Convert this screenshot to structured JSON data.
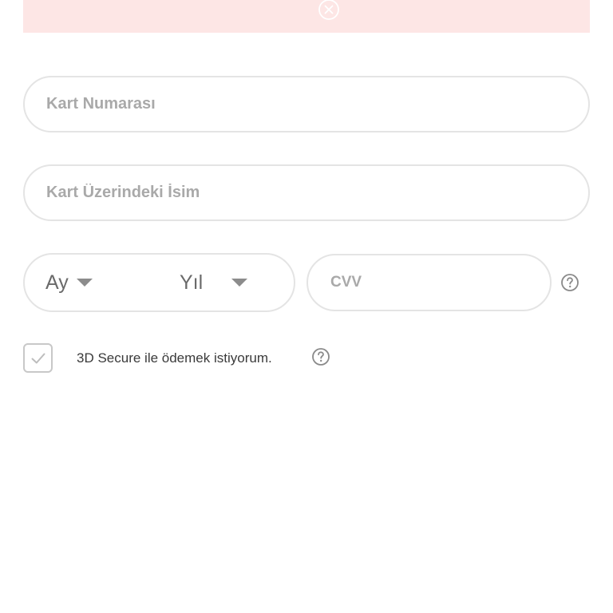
{
  "alert": {
    "close_icon": "close-circle-icon",
    "background_color": "#fde6e5"
  },
  "form": {
    "card_number": {
      "placeholder": "Kart Numarası",
      "value": ""
    },
    "card_name": {
      "placeholder": "Kart Üzerindeki İsim",
      "value": ""
    },
    "expiry": {
      "month_label": "Ay",
      "year_label": "Yıl",
      "dropdown_icon": "caret-down-icon"
    },
    "cvv": {
      "placeholder": "CVV",
      "value": "",
      "help_icon": "question-circle-icon"
    },
    "secure_3d": {
      "label": "3D Secure ile ödemek istiyorum.",
      "checked": true,
      "check_icon": "check-icon",
      "help_icon": "question-circle-icon"
    }
  }
}
